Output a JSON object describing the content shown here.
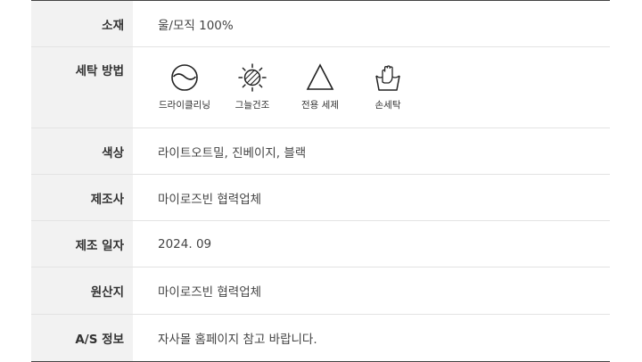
{
  "rows": [
    {
      "label": "소재",
      "value": "울/모직 100%"
    },
    {
      "label": "세탁 방법"
    },
    {
      "label": "색상",
      "value": "라이트오트밀, 진베이지, 블랙"
    },
    {
      "label": "제조사",
      "value": "마이로즈빈 협력업체"
    },
    {
      "label": "제조 일자",
      "value": "2024. 09"
    },
    {
      "label": "원산지",
      "value": "마이로즈빈 협력업체"
    },
    {
      "label": "A/S 정보",
      "value": "자사몰 홈페이지 참고 바랍니다."
    }
  ],
  "care_icons": [
    {
      "icon": "dry-cleaning-icon",
      "label": "드라이클리닝"
    },
    {
      "icon": "shade-dry-icon",
      "label": "그늘건조"
    },
    {
      "icon": "special-detergent-icon",
      "label": "전용 세제"
    },
    {
      "icon": "hand-wash-icon",
      "label": "손세탁"
    }
  ]
}
